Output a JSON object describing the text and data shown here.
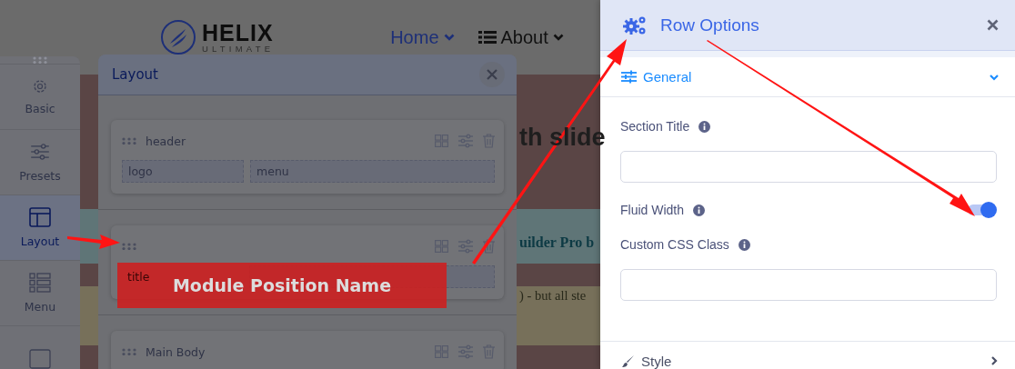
{
  "site": {
    "logo": {
      "name": "HELIX",
      "tagline": "ULTIMATE"
    },
    "nav": [
      {
        "label": "Home",
        "selected": true,
        "kind": "link"
      },
      {
        "label": "About",
        "selected": false,
        "kind": "list"
      }
    ],
    "content": [
      {
        "kind": "heading",
        "text": "th slide"
      },
      {
        "kind": "notice",
        "text": "uilder Pro b"
      },
      {
        "kind": "note",
        "text": ") - but all ste"
      }
    ]
  },
  "sidebar": {
    "items": [
      {
        "label": "Basic",
        "selected": false
      },
      {
        "label": "Presets",
        "selected": false
      },
      {
        "label": "Layout",
        "selected": true
      },
      {
        "label": "Menu",
        "selected": false
      },
      {
        "selected": false
      }
    ]
  },
  "layout_modal": {
    "title": "Layout",
    "rows": [
      {
        "name": "header",
        "columns": [
          {
            "label": "logo"
          },
          {
            "label": "menu"
          }
        ]
      },
      {
        "columns": [
          {
            "label": "title"
          },
          {}
        ]
      },
      {
        "name": "Main Body"
      }
    ]
  },
  "annotation": {
    "label": "Module Position Name"
  },
  "row_options": {
    "title": "Row Options",
    "sections": [
      {
        "title": "General",
        "expanded": true,
        "fields": [
          {
            "kind": "text",
            "label": "Section Title"
          },
          {
            "kind": "toggle",
            "label": "Fluid Width",
            "on": true
          },
          {
            "kind": "text",
            "label": "Custom CSS Class"
          }
        ]
      },
      {
        "title": "Style",
        "expanded": false
      }
    ]
  }
}
